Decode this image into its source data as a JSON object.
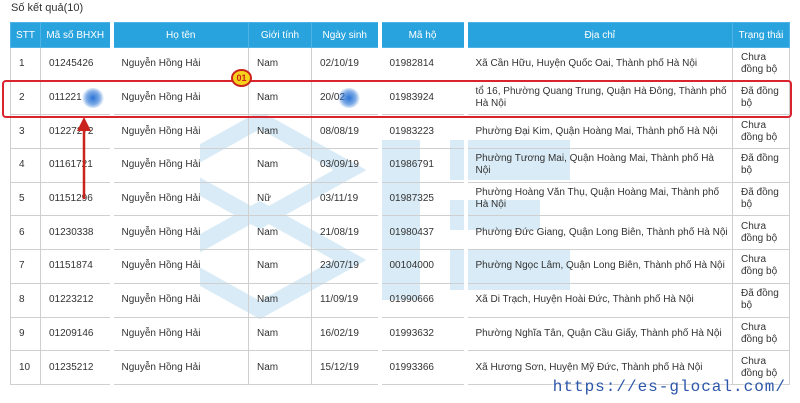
{
  "result_count": "Số kết quả(10)",
  "columns": [
    "STT",
    "Mã số BHXH",
    "Họ tên",
    "Giới tính",
    "Ngày sinh",
    "Mã hộ",
    "Địa chỉ",
    "Trạng thái"
  ],
  "rows": [
    {
      "stt": "1",
      "bhxh": "01245426",
      "name": "Nguyễn Hồng Hải",
      "gender": "Nam",
      "dob": "02/10/19",
      "household": "01982814",
      "address": "Xã Cần Hữu, Huyện Quốc Oai, Thành phố Hà Nội",
      "status": "Chưa đồng bộ"
    },
    {
      "stt": "2",
      "bhxh": "011221",
      "name": "Nguyễn Hồng Hải",
      "gender": "Nam",
      "dob": "20/02",
      "household": "01983924",
      "address": "tổ 16, Phường Quang Trung, Quận Hà Đông, Thành phố Hà Nội",
      "status": "Đã đồng bộ"
    },
    {
      "stt": "3",
      "bhxh": "01227272",
      "name": "Nguyễn Hồng Hải",
      "gender": "Nam",
      "dob": "08/08/19",
      "household": "01983223",
      "address": "Phường Đại Kim, Quận Hoàng Mai, Thành phố Hà Nội",
      "status": "Chưa đồng bộ"
    },
    {
      "stt": "4",
      "bhxh": "01161721",
      "name": "Nguyễn Hồng Hải",
      "gender": "Nam",
      "dob": "03/09/19",
      "household": "01986791",
      "address": "Phường Tương Mai, Quận Hoàng Mai, Thành phố Hà Nội",
      "status": "Đã đồng bộ"
    },
    {
      "stt": "5",
      "bhxh": "01151296",
      "name": "Nguyễn Hồng Hải",
      "gender": "Nữ",
      "dob": "03/11/19",
      "household": "01987325",
      "address": "Phường Hoàng Văn Thụ, Quận Hoàng Mai, Thành phố Hà Nội",
      "status": "Đã đồng bộ"
    },
    {
      "stt": "6",
      "bhxh": "01230338",
      "name": "Nguyễn Hồng Hải",
      "gender": "Nam",
      "dob": "21/08/19",
      "household": "01980437",
      "address": "Phường Đức Giang, Quận Long Biên, Thành phố Hà Nội",
      "status": "Chưa đồng bộ"
    },
    {
      "stt": "7",
      "bhxh": "01151874",
      "name": "Nguyễn Hồng Hải",
      "gender": "Nam",
      "dob": "23/07/19",
      "household": "00104000",
      "address": "Phường Ngọc Lâm, Quận Long Biên, Thành phố Hà Nội",
      "status": "Chưa đồng bộ"
    },
    {
      "stt": "8",
      "bhxh": "01223212",
      "name": "Nguyễn Hồng Hải",
      "gender": "Nam",
      "dob": "11/09/19",
      "household": "01990666",
      "address": "Xã Di Trạch, Huyện Hoài Đức, Thành phố Hà Nội",
      "status": "Đã đồng bộ"
    },
    {
      "stt": "9",
      "bhxh": "01209146",
      "name": "Nguyễn Hồng Hải",
      "gender": "Nam",
      "dob": "16/02/19",
      "household": "01993632",
      "address": "Phường Nghĩa Tân, Quận Cầu Giấy, Thành phố Hà Nội",
      "status": "Chưa đồng bộ"
    },
    {
      "stt": "10",
      "bhxh": "01235212",
      "name": "Nguyễn Hồng Hải",
      "gender": "Nam",
      "dob": "15/12/19",
      "household": "01993366",
      "address": "Xã Hương Sơn, Huyện Mỹ Đức, Thành phố Hà Nội",
      "status": "Chưa đồng bộ"
    }
  ],
  "badge": "01",
  "site_url": "https://es-glocal.com/",
  "colors": {
    "header": "#29a3dd",
    "highlight": "#d9232d",
    "badge": "#f6d21c",
    "url": "#2b55a8"
  }
}
